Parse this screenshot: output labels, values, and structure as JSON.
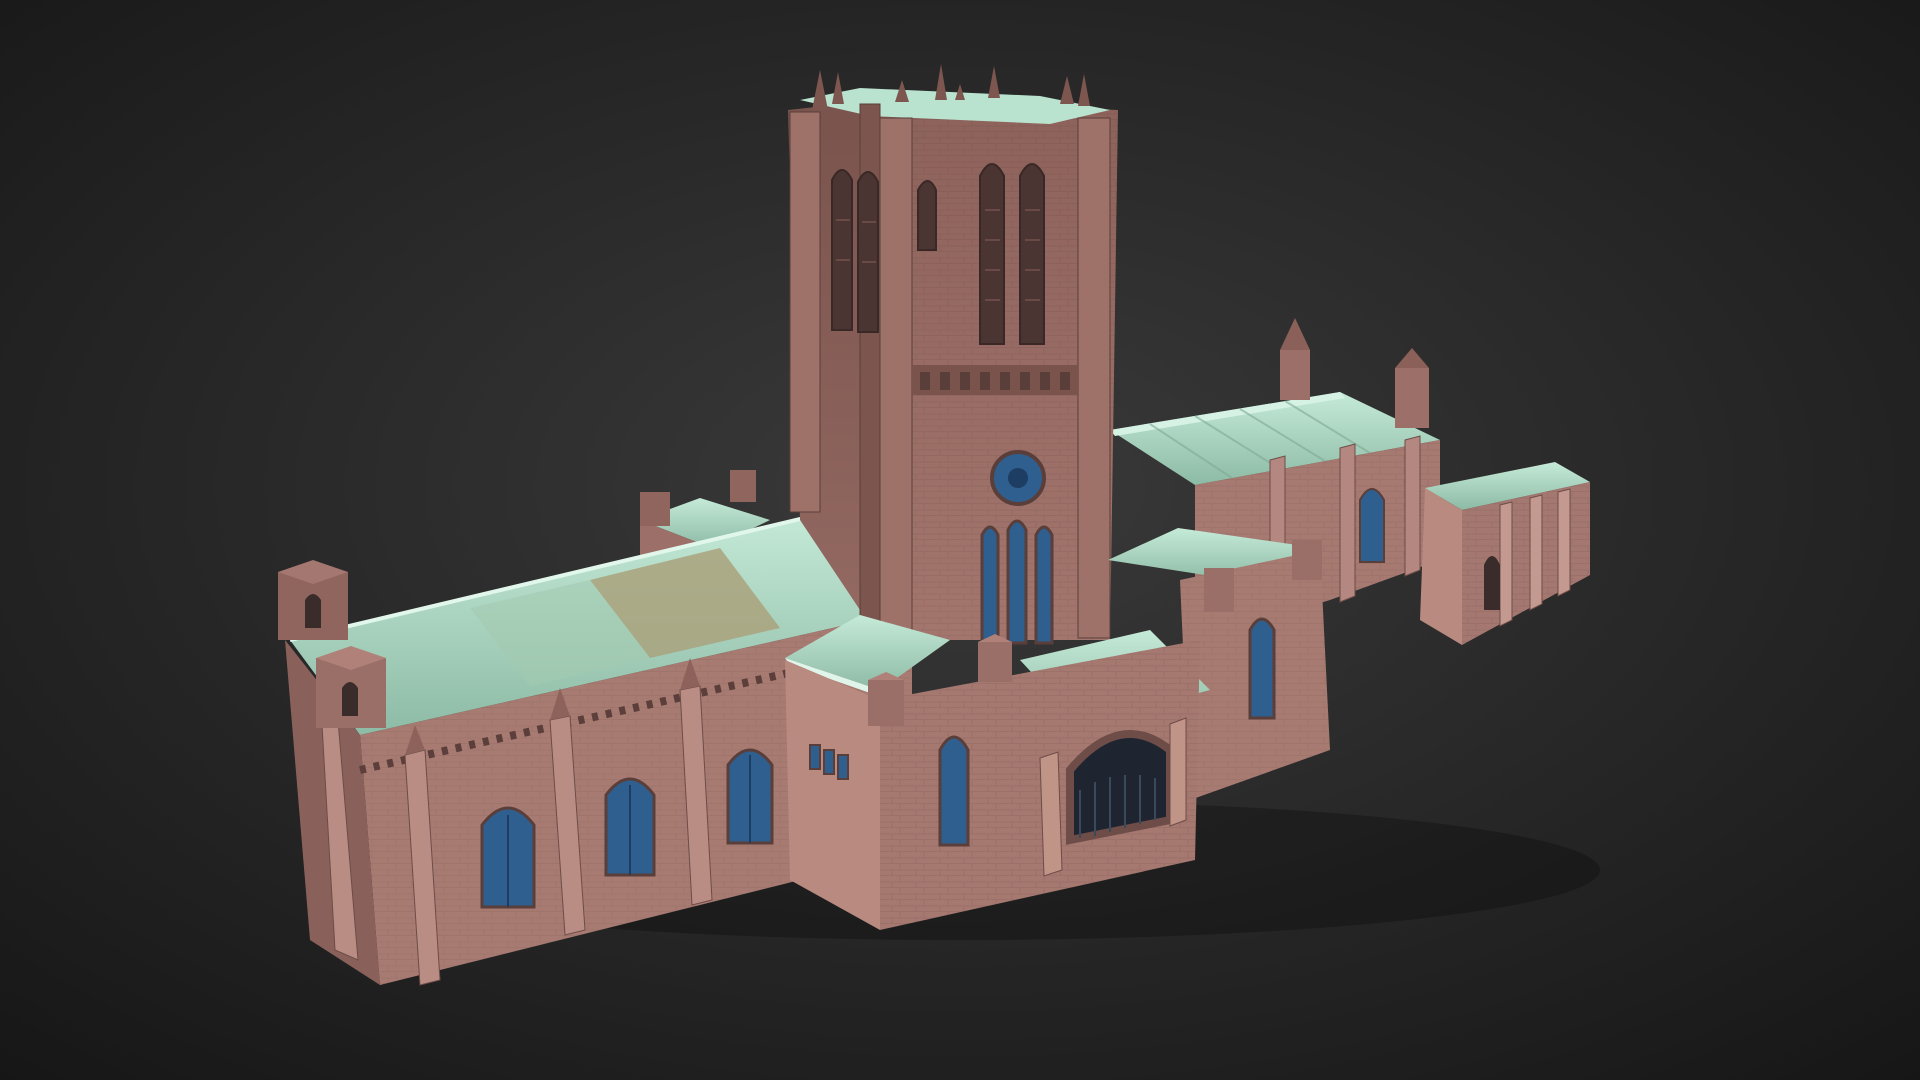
{
  "viewer": {
    "model_subject": "cathedral-3d-model",
    "background": {
      "center": "#3a3a3a",
      "edge": "#161616"
    }
  },
  "colors": {
    "stone_light": "#b88a80",
    "stone_mid": "#9c7068",
    "stone_dark": "#6e4c47",
    "stone_shadow": "#4e3532",
    "roof_light": "#b9e2cf",
    "roof_mid": "#94c3ad",
    "roof_dark": "#6f9a86",
    "roof_worn": "#a9a27c",
    "glass": "#2f5f8f",
    "glass_dark": "#1d3d63",
    "door": "#1e2430"
  }
}
